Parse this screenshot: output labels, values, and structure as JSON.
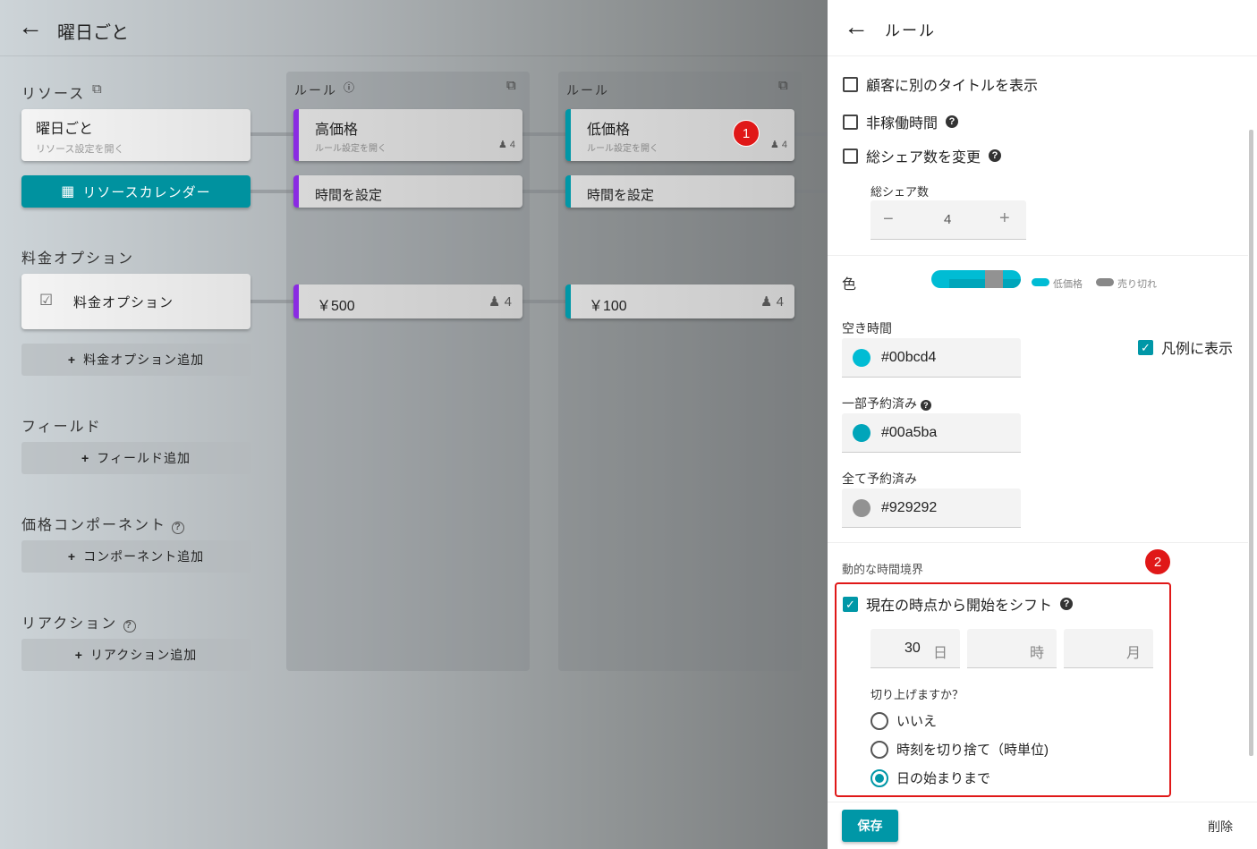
{
  "header": {
    "title": "曜日ごと"
  },
  "resources": {
    "heading": "リソース",
    "card_title": "曜日ごと",
    "card_sub": "リソース設定を開く",
    "calendar_button": "リソースカレンダー"
  },
  "pricing": {
    "heading": "料金オプション",
    "card_label": "料金オプション",
    "add": "料金オプション追加"
  },
  "fields": {
    "heading": "フィールド",
    "add": "フィールド追加"
  },
  "components": {
    "heading": "価格コンポーネント",
    "add": "コンポーネント追加"
  },
  "reactions": {
    "heading": "リアクション",
    "add": "リアクション追加"
  },
  "rule_columns": [
    {
      "heading": "ルール",
      "name": "高価格",
      "sub": "ルール設定を開く",
      "count": "4",
      "time": "時間を設定",
      "price": "￥500",
      "price_count": "4",
      "color": "#8a2be2"
    },
    {
      "heading": "ルール",
      "name": "低価格",
      "sub": "ルール設定を開く",
      "count": "4",
      "time": "時間を設定",
      "price": "￥100",
      "price_count": "4",
      "color": "#0097a7"
    }
  ],
  "badges": [
    "1",
    "2"
  ],
  "panel": {
    "title": "ルール",
    "show_alt_title": "顧客に別のタイトルを表示",
    "non_working": "非稼働時間",
    "change_shares": "総シェア数を変更",
    "shares_label": "総シェア数",
    "shares_value": "4",
    "color_label": "色",
    "legend_low": "低価格",
    "legend_sold": "売り切れ",
    "available_label": "空き時間",
    "available_color": "#00bcd4",
    "show_legend": "凡例に表示",
    "partial_label": "一部予約済み",
    "partial_color": "#00a5ba",
    "full_label": "全て予約済み",
    "full_color": "#929292",
    "dynamic_label": "動的な時間境界",
    "shift_label": "現在の時点から開始をシフト",
    "days_value": "30",
    "days_unit": "日",
    "hours_unit": "時",
    "months_unit": "月",
    "round_question": "切り上げますか？",
    "options": [
      "いいえ",
      "時刻を切り捨て（時単位)",
      "日の始まりまで"
    ],
    "selected_option": 2,
    "save": "保存",
    "delete": "削除"
  }
}
